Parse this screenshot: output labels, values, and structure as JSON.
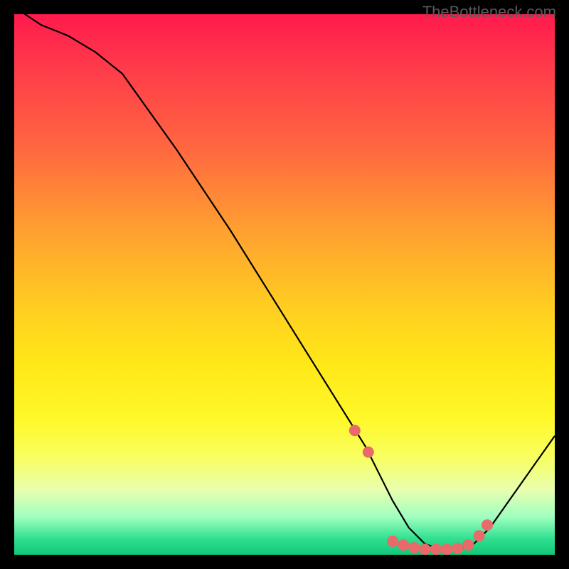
{
  "watermark": "TheBottleneck.com",
  "chart_data": {
    "type": "line",
    "title": "",
    "xlabel": "",
    "ylabel": "",
    "xlim": [
      0,
      100
    ],
    "ylim": [
      0,
      100
    ],
    "grid": false,
    "legend": false,
    "series": [
      {
        "name": "curve",
        "x": [
          0,
          2,
          5,
          10,
          15,
          20,
          30,
          40,
          50,
          55,
          60,
          65,
          70,
          73,
          76,
          79,
          82,
          85,
          88,
          100
        ],
        "y": [
          102,
          100,
          98,
          96,
          93,
          89,
          75,
          60,
          44,
          36,
          28,
          20,
          10,
          5,
          2,
          1,
          1,
          2,
          5,
          22
        ]
      }
    ],
    "markers": {
      "name": "highlight-points",
      "x": [
        63,
        65.5,
        70,
        72,
        74,
        76,
        78,
        80,
        82,
        84,
        86,
        87.5
      ],
      "y": [
        23,
        19,
        2.5,
        1.8,
        1.3,
        1.0,
        1.0,
        1.0,
        1.2,
        1.8,
        3.5,
        5.5
      ]
    },
    "accent": "#e86a6a",
    "line_color": "#000000"
  }
}
